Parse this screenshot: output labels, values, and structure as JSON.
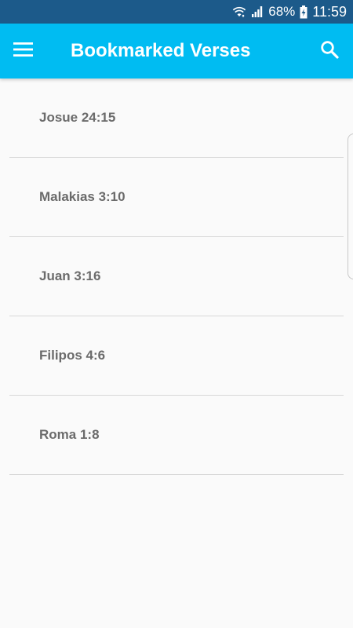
{
  "status_bar": {
    "battery_percent": "68%",
    "time": "11:59",
    "icons": [
      "wifi-icon",
      "signal-icon",
      "battery-charging-icon"
    ]
  },
  "app_bar": {
    "title": "Bookmarked Verses",
    "menu_icon": "hamburger-menu-icon",
    "search_icon": "search-icon",
    "background_color": "#00bcf2"
  },
  "bookmarks": [
    {
      "reference": "Josue 24:15"
    },
    {
      "reference": "Malakias 3:10"
    },
    {
      "reference": "Juan 3:16"
    },
    {
      "reference": "Filipos 4:6"
    },
    {
      "reference": "Roma 1:8"
    }
  ]
}
